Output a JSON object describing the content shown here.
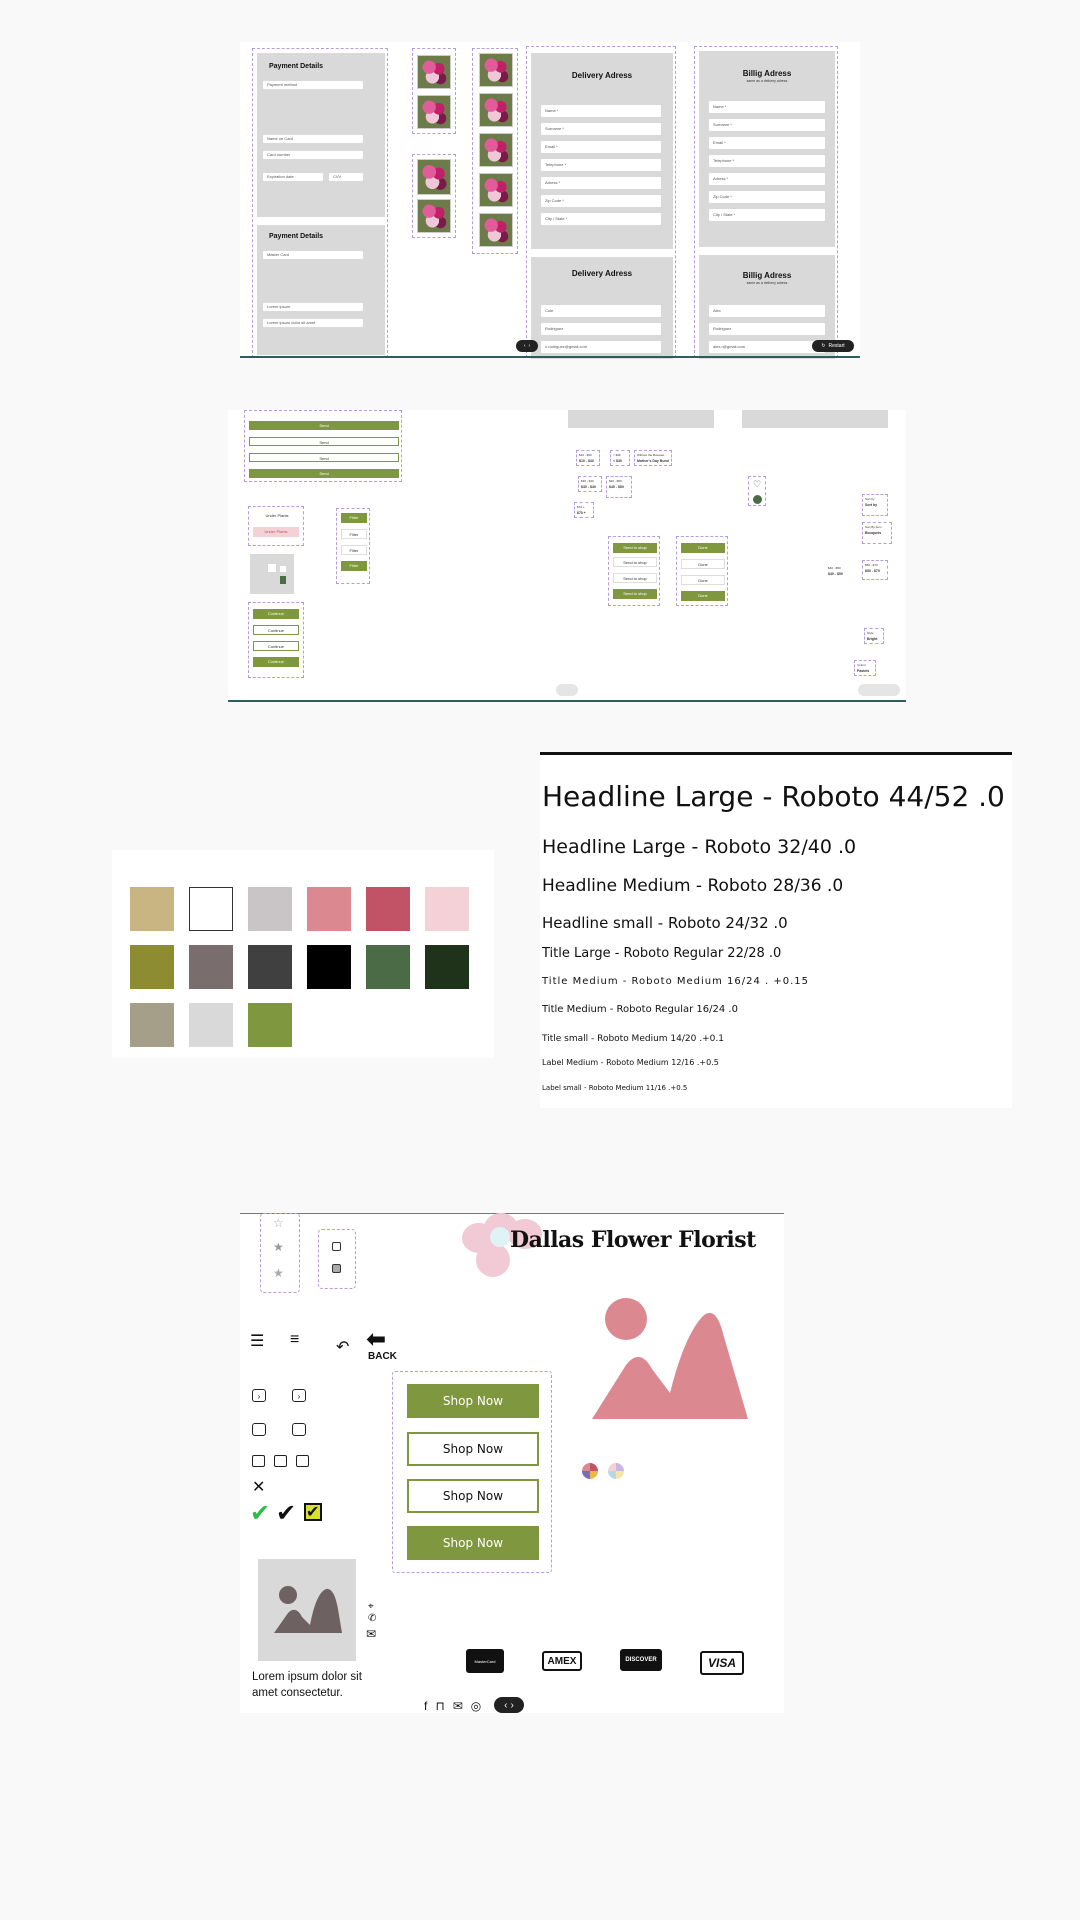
{
  "payment": {
    "title1": "Payment Details",
    "title2": "Payment Details",
    "method_placeholder": "Payment method",
    "method_value": "Master Card",
    "name_on_card": "Name on Card",
    "card_number": "Card number",
    "expiration": "Expiration date",
    "cvv": "CVV",
    "lorem1": "Lorem ipsum",
    "lorem2": "Lorem ipsum dolor sit amet"
  },
  "delivery": {
    "title1": "Delivery Adress",
    "title2": "Delivery Adress",
    "fields": [
      "Name *",
      "Surname *",
      "Email *",
      "Telephone *",
      "Adress *",
      "Zip Code *",
      "City / State *"
    ],
    "filled": [
      "Cole",
      "Rodriguez",
      "c.rodriguez@gmail.com"
    ]
  },
  "billing": {
    "title1": "Billig Adress",
    "title2": "Billig Adress",
    "same_label": "same as a delivery adress",
    "fields": [
      "Name *",
      "Surname *",
      "Email *",
      "Telephone *",
      "Adress *",
      "Zip Code *",
      "City / State *"
    ],
    "filled": [
      "Alex",
      "Rodriguez",
      "alex.r@gmail.com"
    ]
  },
  "player": {
    "restart_label": "Restart"
  },
  "buttons": {
    "send": "Send",
    "filter": "Filter",
    "continue": "Continue",
    "send_to_shop": "Send to shop",
    "done": "Done",
    "under_plants": "Under Plants"
  },
  "price_tags": [
    {
      "label": "$10 - $50",
      "value": "$10 - $40"
    },
    {
      "label": "< $30",
      "value": "< $30"
    },
    {
      "label": "Without the Bouquet",
      "value": "Mother's Day Bund"
    },
    {
      "label": "$30 - $40",
      "value": "$30 - $40"
    },
    {
      "label": "$40 - $50",
      "value": "$40 - $50"
    },
    {
      "label": "$70 +",
      "value": "$70 +"
    },
    {
      "label": "$40 - $50",
      "value": "$40 - $50"
    },
    {
      "label": "$50 - $70",
      "value": "$50 - $70"
    },
    {
      "label": "Sort by",
      "value": "Sort by"
    },
    {
      "label": "Sort By Item",
      "value": "Bouquets"
    },
    {
      "label": "Style",
      "value": "Bright"
    },
    {
      "label": "Colour",
      "value": "Pastels"
    }
  ],
  "palette": {
    "colors": [
      "#c8b582",
      "#ffffff",
      "#c9c4c5",
      "#db8891",
      "#c25367",
      "#f4d0d7",
      "#8e8c32",
      "#7a6d6d",
      "#404040",
      "#000000",
      "#4a6b46",
      "#1f331a",
      "#a59e89",
      "#d9d9d9",
      "#7f983f"
    ]
  },
  "typography": [
    {
      "text": "Headline Large - Roboto 44/52 .0",
      "size": 28
    },
    {
      "text": "Headline Large - Roboto 32/40 .0",
      "size": 19
    },
    {
      "text": "Headline Medium - Roboto 28/36 .0",
      "size": 17
    },
    {
      "text": "Headline small - Roboto 24/32 .0",
      "size": 15
    },
    {
      "text": "Title Large - Roboto Regular 22/28 .0",
      "size": 13
    },
    {
      "text": "Title Medium - Roboto Medium 16/24 . +0.15",
      "size": 10
    },
    {
      "text": "Title Medium - Roboto Regular 16/24 .0",
      "size": 10
    },
    {
      "text": "Title small - Roboto Medium 14/20 .+0.1",
      "size": 9
    },
    {
      "text": "Label Medium - Roboto Medium 12/16 .+0.5",
      "size": 8
    },
    {
      "text": "Label small - Roboto Medium 11/16 .+0.5",
      "size": 7
    }
  ],
  "bottom": {
    "brand": "Dallas Flower Florist",
    "back_label": "BACK",
    "shop_now": "Shop Now",
    "lorem": "Lorem ipsum dolor sit amet consectetur.",
    "cards": [
      "MasterCard",
      "AMEX",
      "DISCOVER",
      "VISA"
    ]
  },
  "icons": [
    "chevron-left-icon",
    "chevron-right-icon",
    "restart-icon",
    "heart-icon",
    "star-icon",
    "checkbox-icon",
    "sliders-icon",
    "undo-icon",
    "back-arrow-icon",
    "calendar-icon",
    "close-icon",
    "check-icon",
    "pin-icon",
    "phone-icon",
    "mail-icon",
    "instagram-icon",
    "facebook-icon"
  ]
}
